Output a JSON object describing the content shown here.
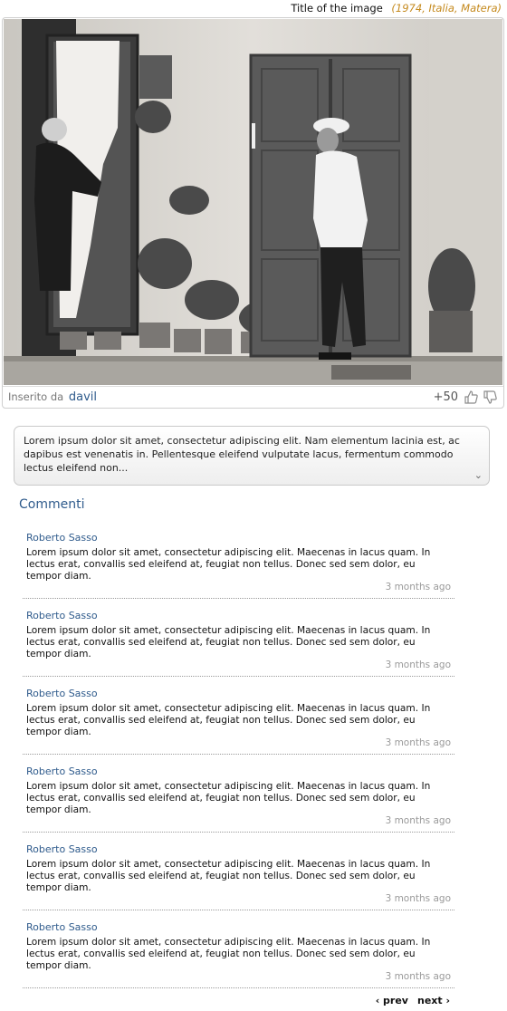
{
  "photo": {
    "title": "Title of the image",
    "meta": "(1974, Italia, Matera)",
    "uploaded_label": "Inserito da",
    "uploader": "davil",
    "score": "+50"
  },
  "description": {
    "text": "Lorem ipsum dolor sit amet, consectetur adipiscing elit. Nam elementum lacinia est, ac dapibus est venenatis in. Pellentesque eleifend vulputate lacus, fermentum commodo lectus eleifend non...",
    "expand_icon": "chevron-down-icon"
  },
  "comments": {
    "heading": "Commenti",
    "items": [
      {
        "author": "Roberto Sasso",
        "text": "Lorem ipsum dolor sit amet, consectetur adipiscing elit. Maecenas in lacus quam. In lectus erat, convallis sed eleifend at, feugiat non tellus. Donec sed sem dolor, eu tempor diam.",
        "time": "3 months ago"
      },
      {
        "author": "Roberto Sasso",
        "text": "Lorem ipsum dolor sit amet, consectetur adipiscing elit. Maecenas in lacus quam. In lectus erat, convallis sed eleifend at, feugiat non tellus. Donec sed sem dolor, eu tempor diam.",
        "time": "3 months ago"
      },
      {
        "author": "Roberto Sasso",
        "text": "Lorem ipsum dolor sit amet, consectetur adipiscing elit. Maecenas in lacus quam. In lectus erat, convallis sed eleifend at, feugiat non tellus. Donec sed sem dolor, eu tempor diam.",
        "time": "3 months ago"
      },
      {
        "author": "Roberto Sasso",
        "text": "Lorem ipsum dolor sit amet, consectetur adipiscing elit. Maecenas in lacus quam. In lectus erat, convallis sed eleifend at, feugiat non tellus. Donec sed sem dolor, eu tempor diam.",
        "time": "3 months ago"
      },
      {
        "author": "Roberto Sasso",
        "text": "Lorem ipsum dolor sit amet, consectetur adipiscing elit. Maecenas in lacus quam. In lectus erat, convallis sed eleifend at, feugiat non tellus. Donec sed sem dolor, eu tempor diam.",
        "time": "3 months ago"
      },
      {
        "author": "Roberto Sasso",
        "text": "Lorem ipsum dolor sit amet, consectetur adipiscing elit. Maecenas in lacus quam. In lectus erat, convallis sed eleifend at, feugiat non tellus. Donec sed sem dolor, eu tempor diam.",
        "time": "3 months ago"
      }
    ]
  },
  "pagination": {
    "prev": "‹ prev",
    "next": "next ›"
  },
  "icons": {
    "like": "thumbs-up-icon",
    "dislike": "thumbs-down-icon"
  },
  "colors": {
    "link": "#2f5b8c",
    "meta": "#c58a1e",
    "muted": "#9a9a9a"
  }
}
